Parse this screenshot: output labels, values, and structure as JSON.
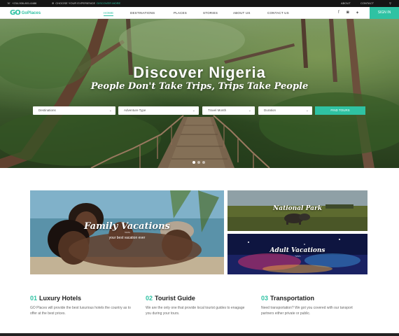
{
  "topbar": {
    "phone": "+234-906-801-6486",
    "choose": "CHOOSE YOUR EXPERIENCE",
    "choose_link": "DISCOVER MORE",
    "about": "ABOUT",
    "contact": "CONTACT"
  },
  "brand": {
    "mark": "GO",
    "name": "GoPlaces",
    "accent": "#2fc2a3"
  },
  "menu": [
    "HOME",
    "DESTINATIONS",
    "PLACES",
    "STORIES",
    "ABOUT US",
    "CONTACT US"
  ],
  "signin": "SIGN IN",
  "hero": {
    "title": "Discover Nigeria",
    "subtitle": "People Don't Take Trips, Trips Take People",
    "fields": [
      "Destinations",
      "Adventure Type",
      "Travel Month",
      "Duration"
    ],
    "button": "FIND TOURS",
    "slide_count": 3,
    "active_slide": 1
  },
  "cards": {
    "family": {
      "title": "Family Vacations",
      "caption": "your best vacation ever",
      "ornament": "~~~"
    },
    "park": {
      "title": "National Park"
    },
    "adult": {
      "title": "Adult Vacations",
      "ornament": "~~~"
    }
  },
  "features": [
    {
      "num": "01",
      "title": "Luxury Hotels",
      "text": "GO Places will provide the best luxurious hotels the country as to offer at the best prices."
    },
    {
      "num": "02",
      "title": "Tourist Guide",
      "text": "We are the only one that provide local tourist guides to enagage you during your tours."
    },
    {
      "num": "03",
      "title": "Transportation",
      "text": "Need transportation? We got you covered with our tansport partners either private or public."
    }
  ]
}
